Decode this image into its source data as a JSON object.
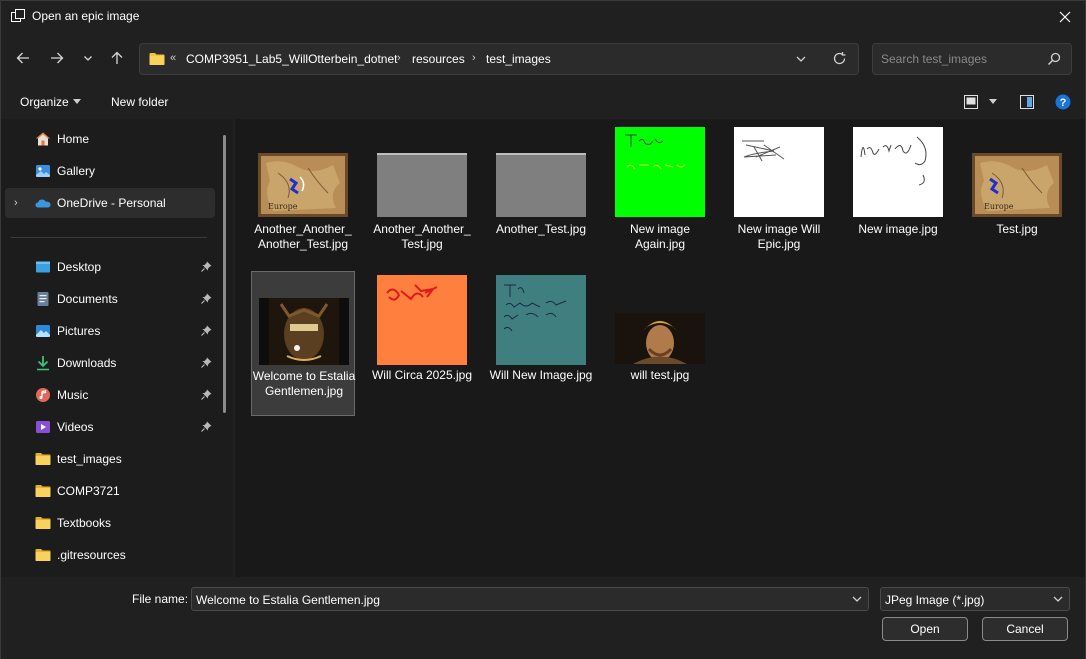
{
  "window": {
    "title": "Open an epic image",
    "close_icon": "close-icon"
  },
  "address": {
    "overflow": "«",
    "crumbs": [
      "COMP3951_Lab5_WillOtterbein_dotnet",
      "resources",
      "test_images"
    ]
  },
  "search": {
    "placeholder": "Search test_images"
  },
  "commandbar": {
    "organize": "Organize",
    "new_folder": "New folder"
  },
  "sidebar": {
    "top": [
      {
        "label": "Home",
        "icon": "home-icon"
      },
      {
        "label": "Gallery",
        "icon": "gallery-icon"
      },
      {
        "label": "OneDrive - Personal",
        "icon": "onedrive-icon",
        "selected": true
      }
    ],
    "quick": [
      {
        "label": "Desktop",
        "icon": "desktop-icon",
        "pinned": true
      },
      {
        "label": "Documents",
        "icon": "documents-icon",
        "pinned": true
      },
      {
        "label": "Pictures",
        "icon": "pictures-icon",
        "pinned": true
      },
      {
        "label": "Downloads",
        "icon": "downloads-icon",
        "pinned": true
      },
      {
        "label": "Music",
        "icon": "music-icon",
        "pinned": true
      },
      {
        "label": "Videos",
        "icon": "videos-icon",
        "pinned": true
      },
      {
        "label": "test_images",
        "icon": "folder-icon"
      },
      {
        "label": "COMP3721",
        "icon": "folder-icon"
      },
      {
        "label": "Textbooks",
        "icon": "folder-icon"
      },
      {
        "label": ".gitresources",
        "icon": "folder-icon"
      }
    ]
  },
  "files": [
    {
      "name": "Another_Another_Another_Test.jpg",
      "thumb": "map"
    },
    {
      "name": "Another_Another_Test.jpg",
      "thumb": "gray"
    },
    {
      "name": "Another_Test.jpg",
      "thumb": "gray"
    },
    {
      "name": "New image Again.jpg",
      "thumb": "green"
    },
    {
      "name": "New image Will Epic.jpg",
      "thumb": "white-scribble"
    },
    {
      "name": "New image.jpg",
      "thumb": "white-handwriting"
    },
    {
      "name": "Test.jpg",
      "thumb": "map"
    },
    {
      "name": "Welcome to Estalia Gentlemen.jpg",
      "thumb": "portrait-dark",
      "selected": true
    },
    {
      "name": "Will Circa 2025.jpg",
      "thumb": "orange"
    },
    {
      "name": "Will New Image.jpg",
      "thumb": "teal"
    },
    {
      "name": "will test.jpg",
      "thumb": "portrait-warrior"
    }
  ],
  "footer": {
    "filename_label": "File name:",
    "filename_value": "Welcome to Estalia Gentlemen.jpg",
    "filetype": "JPeg Image (*.jpg)",
    "open": "Open",
    "cancel": "Cancel"
  },
  "colors": {
    "window_bg": "#202020",
    "pane_bg": "#191919",
    "accent": "#0078d4",
    "folder": "#f3c33a",
    "green_thumb": "#00ff00",
    "orange_thumb": "#ff7f3f",
    "teal_thumb": "#3f7f7f",
    "gray_thumb": "#7f7f7f"
  }
}
